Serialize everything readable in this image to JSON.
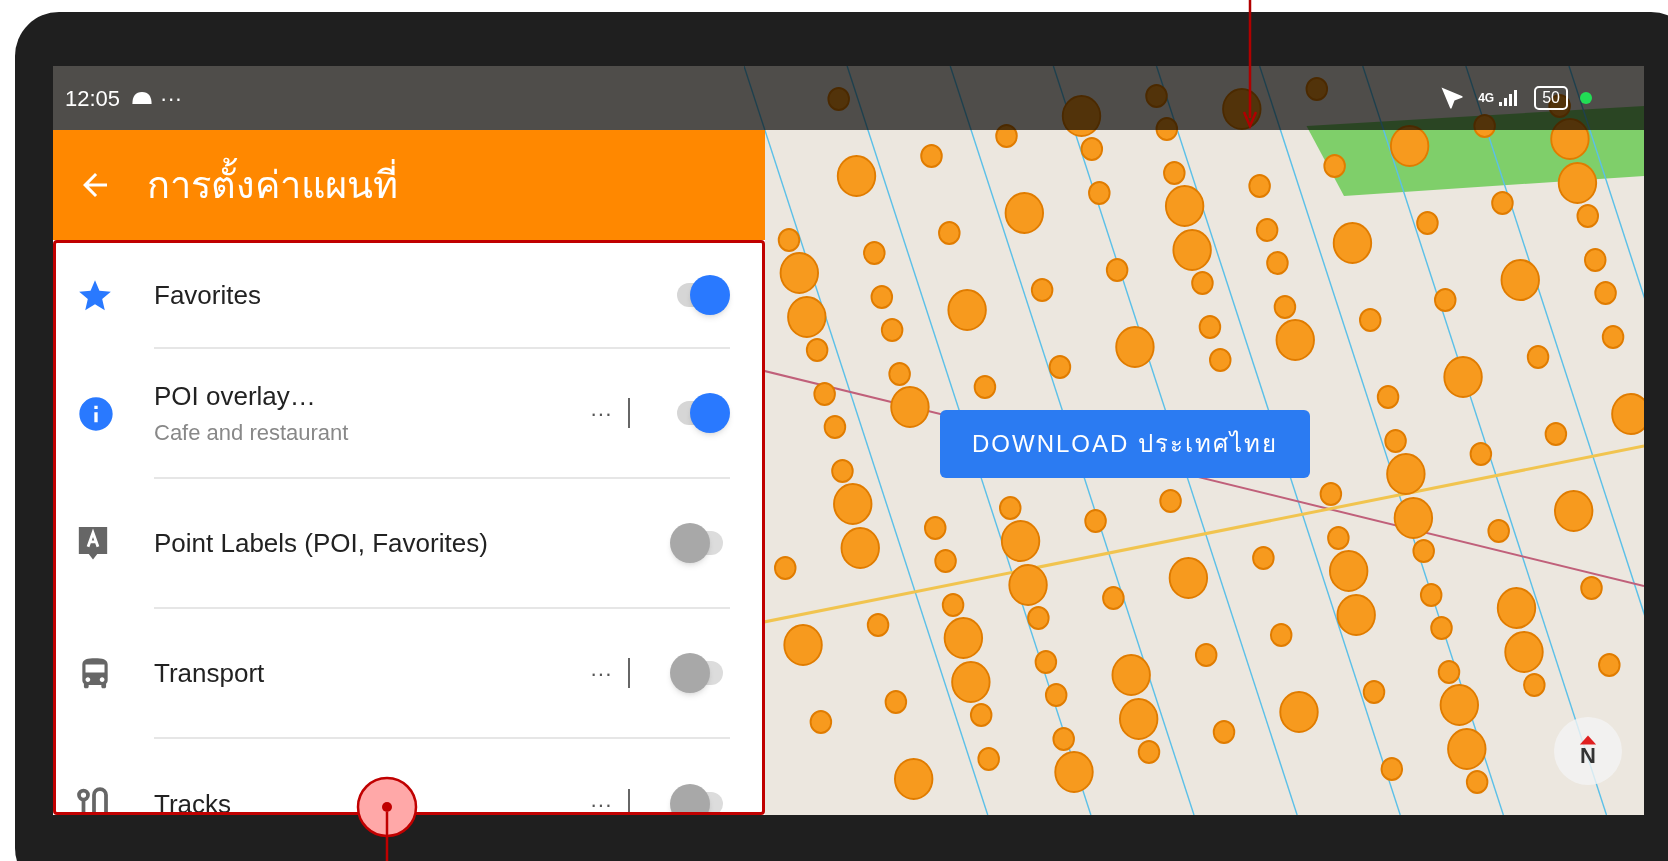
{
  "status_bar": {
    "time": "12:05",
    "more": "···",
    "network": "4G",
    "battery": "50"
  },
  "panel": {
    "title": "การตั้งค่าแผนที่",
    "items": [
      {
        "kind": "star",
        "label": "Favorites",
        "on": true
      },
      {
        "kind": "info",
        "label": "POI overlay…",
        "subtitle": "Cafe and restaurant",
        "more": "···",
        "on": true
      },
      {
        "kind": "label",
        "label": "Point Labels (POI, Favorites)",
        "on": false
      },
      {
        "kind": "bus",
        "label": "Transport",
        "more": "···",
        "on": false
      },
      {
        "kind": "tracks",
        "label": "Tracks",
        "more": "···",
        "on": false
      }
    ]
  },
  "map": {
    "download_button": "DOWNLOAD ประเทศไทย",
    "compass": "N"
  }
}
